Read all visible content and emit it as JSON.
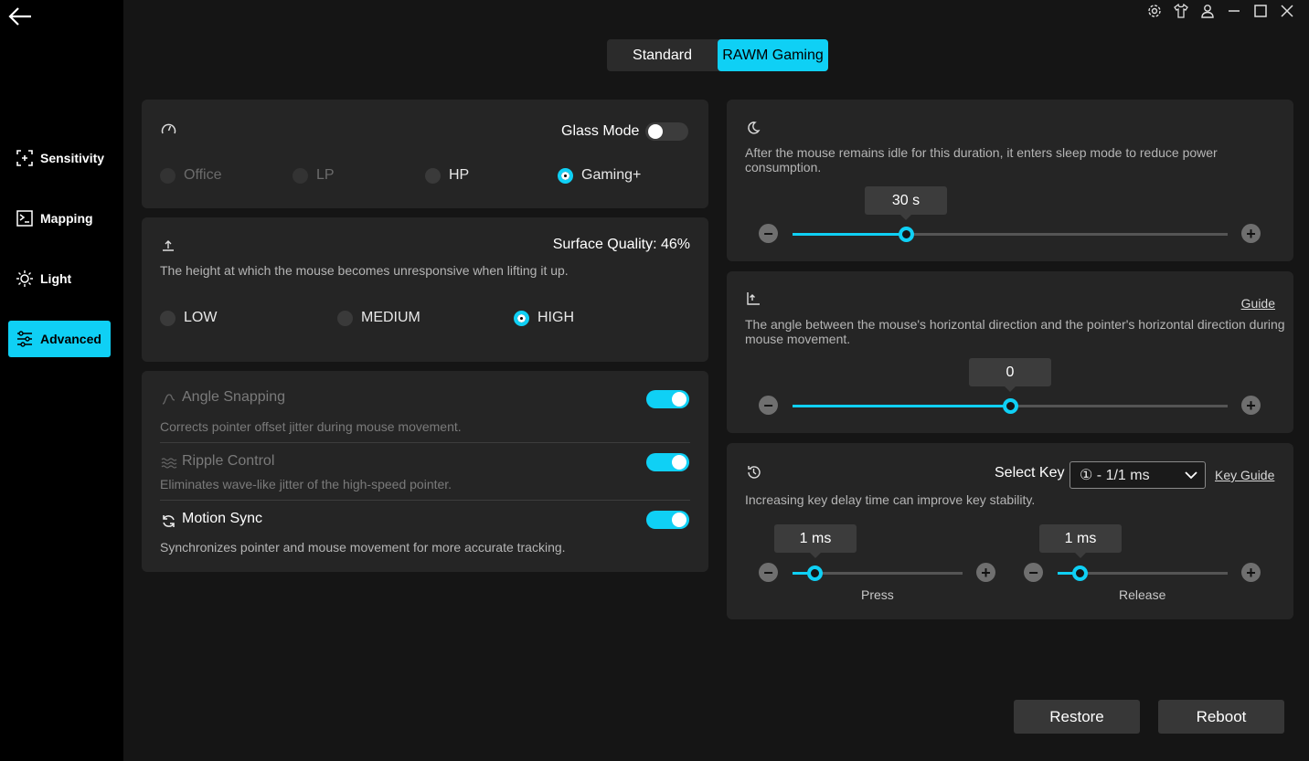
{
  "sidebar": {
    "back_icon": "back-arrow-icon",
    "items": [
      {
        "label": "Sensitivity",
        "icon": "crosshair-icon"
      },
      {
        "label": "Mapping",
        "icon": "terminal-icon"
      },
      {
        "label": "Light",
        "icon": "sun-icon"
      },
      {
        "label": "Advanced",
        "icon": "sliders-icon",
        "active": true
      }
    ]
  },
  "titlebar": {
    "icons": [
      "gear-icon",
      "shirt-icon",
      "user-icon",
      "minimize-icon",
      "maximize-icon",
      "close-icon"
    ]
  },
  "mode_tabs": {
    "standard": "Standard",
    "rawm": "RAWM Gaming",
    "selected": "RAWM Gaming"
  },
  "polling_card": {
    "icon": "gauge-icon",
    "glass_mode_label": "Glass Mode",
    "glass_mode_on": false,
    "options": [
      "Office",
      "LP",
      "HP",
      "Gaming+"
    ],
    "selected": "Gaming+"
  },
  "lod_card": {
    "icon": "lift-icon",
    "surface_quality": "Surface Quality: 46%",
    "description": "The height at which the mouse becomes unresponsive when lifting it up.",
    "options": [
      "LOW",
      "MEDIUM",
      "HIGH"
    ],
    "selected": "HIGH"
  },
  "toggles_card": {
    "angle_snapping": {
      "label": "Angle Snapping",
      "desc": "Corrects pointer offset jitter during mouse movement.",
      "on": true
    },
    "ripple_control": {
      "label": "Ripple Control",
      "desc": "Eliminates wave-like jitter of the high-speed pointer.",
      "on": true
    },
    "motion_sync": {
      "label": "Motion Sync",
      "desc": "Synchronizes pointer and mouse movement for more accurate tracking.",
      "on": true
    }
  },
  "sleep_card": {
    "icon": "moon-icon",
    "description": "After the mouse remains idle for this duration, it enters sleep mode to reduce power consumption.",
    "value": "30 s",
    "level_fraction": 0.26
  },
  "angle_card": {
    "icon": "angle-icon",
    "guide": "Guide",
    "description": "The angle between the mouse's horizontal direction and the pointer's horizontal direction during mouse movement.",
    "value": "0",
    "level_fraction": 0.5
  },
  "debounce_card": {
    "icon": "history-icon",
    "select_key_label": "Select Key",
    "select_value": "① - 1/1 ms",
    "key_guide": "Key Guide",
    "description": "Increasing key delay time can improve key stability.",
    "press": {
      "label": "Press",
      "value": "1 ms",
      "level_fraction": 0.13
    },
    "release": {
      "label": "Release",
      "value": "1 ms",
      "level_fraction": 0.13
    }
  },
  "footer": {
    "restore": "Restore",
    "reboot": "Reboot"
  },
  "colors": {
    "accent": "#0fd0f5",
    "card": "#252525",
    "sidebar": "#000000"
  }
}
